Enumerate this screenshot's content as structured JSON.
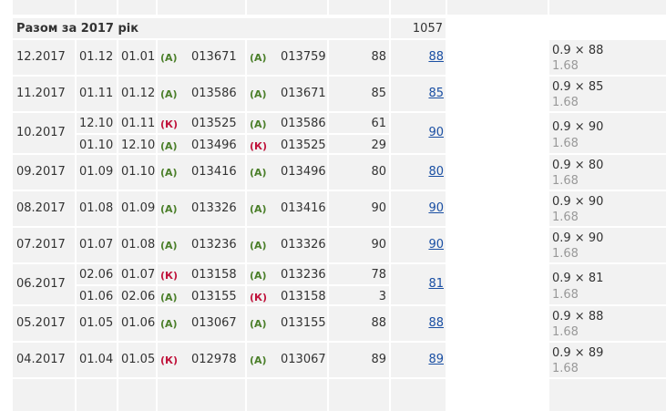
{
  "summary": {
    "label": "Разом за 2017 рік",
    "total": "1057"
  },
  "colors": {
    "a": "#4b7f2a",
    "k": "#c0143c",
    "link": "#1a4fa3"
  },
  "rows": [
    {
      "period": "12.2017",
      "subrows": [
        {
          "from": "01.12",
          "to": "01.01",
          "b1": "(А)",
          "start": "013671",
          "b2": "(А)",
          "end": "013759",
          "qty": "88"
        }
      ],
      "total": "88",
      "formula": "0.9 × 88",
      "rate": "1.68"
    },
    {
      "period": "11.2017",
      "subrows": [
        {
          "from": "01.11",
          "to": "01.12",
          "b1": "(А)",
          "start": "013586",
          "b2": "(А)",
          "end": "013671",
          "qty": "85"
        }
      ],
      "total": "85",
      "formula": "0.9 × 85",
      "rate": "1.68"
    },
    {
      "period": "10.2017",
      "subrows": [
        {
          "from": "12.10",
          "to": "01.11",
          "b1": "(К)",
          "start": "013525",
          "b2": "(А)",
          "end": "013586",
          "qty": "61"
        },
        {
          "from": "01.10",
          "to": "12.10",
          "b1": "(А)",
          "start": "013496",
          "b2": "(К)",
          "end": "013525",
          "qty": "29"
        }
      ],
      "total": "90",
      "formula": "0.9 × 90",
      "rate": "1.68"
    },
    {
      "period": "09.2017",
      "subrows": [
        {
          "from": "01.09",
          "to": "01.10",
          "b1": "(А)",
          "start": "013416",
          "b2": "(А)",
          "end": "013496",
          "qty": "80"
        }
      ],
      "total": "80",
      "formula": "0.9 × 80",
      "rate": "1.68"
    },
    {
      "period": "08.2017",
      "subrows": [
        {
          "from": "01.08",
          "to": "01.09",
          "b1": "(А)",
          "start": "013326",
          "b2": "(А)",
          "end": "013416",
          "qty": "90"
        }
      ],
      "total": "90",
      "formula": "0.9 × 90",
      "rate": "1.68"
    },
    {
      "period": "07.2017",
      "subrows": [
        {
          "from": "01.07",
          "to": "01.08",
          "b1": "(А)",
          "start": "013236",
          "b2": "(А)",
          "end": "013326",
          "qty": "90"
        }
      ],
      "total": "90",
      "formula": "0.9 × 90",
      "rate": "1.68"
    },
    {
      "period": "06.2017",
      "subrows": [
        {
          "from": "02.06",
          "to": "01.07",
          "b1": "(К)",
          "start": "013158",
          "b2": "(А)",
          "end": "013236",
          "qty": "78"
        },
        {
          "from": "01.06",
          "to": "02.06",
          "b1": "(А)",
          "start": "013155",
          "b2": "(К)",
          "end": "013158",
          "qty": "3"
        }
      ],
      "total": "81",
      "formula": "0.9 × 81",
      "rate": "1.68"
    },
    {
      "period": "05.2017",
      "subrows": [
        {
          "from": "01.05",
          "to": "01.06",
          "b1": "(А)",
          "start": "013067",
          "b2": "(А)",
          "end": "013155",
          "qty": "88"
        }
      ],
      "total": "88",
      "formula": "0.9 × 88",
      "rate": "1.68"
    },
    {
      "period": "04.2017",
      "subrows": [
        {
          "from": "01.04",
          "to": "01.05",
          "b1": "(К)",
          "start": "012978",
          "b2": "(А)",
          "end": "013067",
          "qty": "89"
        }
      ],
      "total": "89",
      "formula": "0.9 × 89",
      "rate": "1.68"
    }
  ]
}
